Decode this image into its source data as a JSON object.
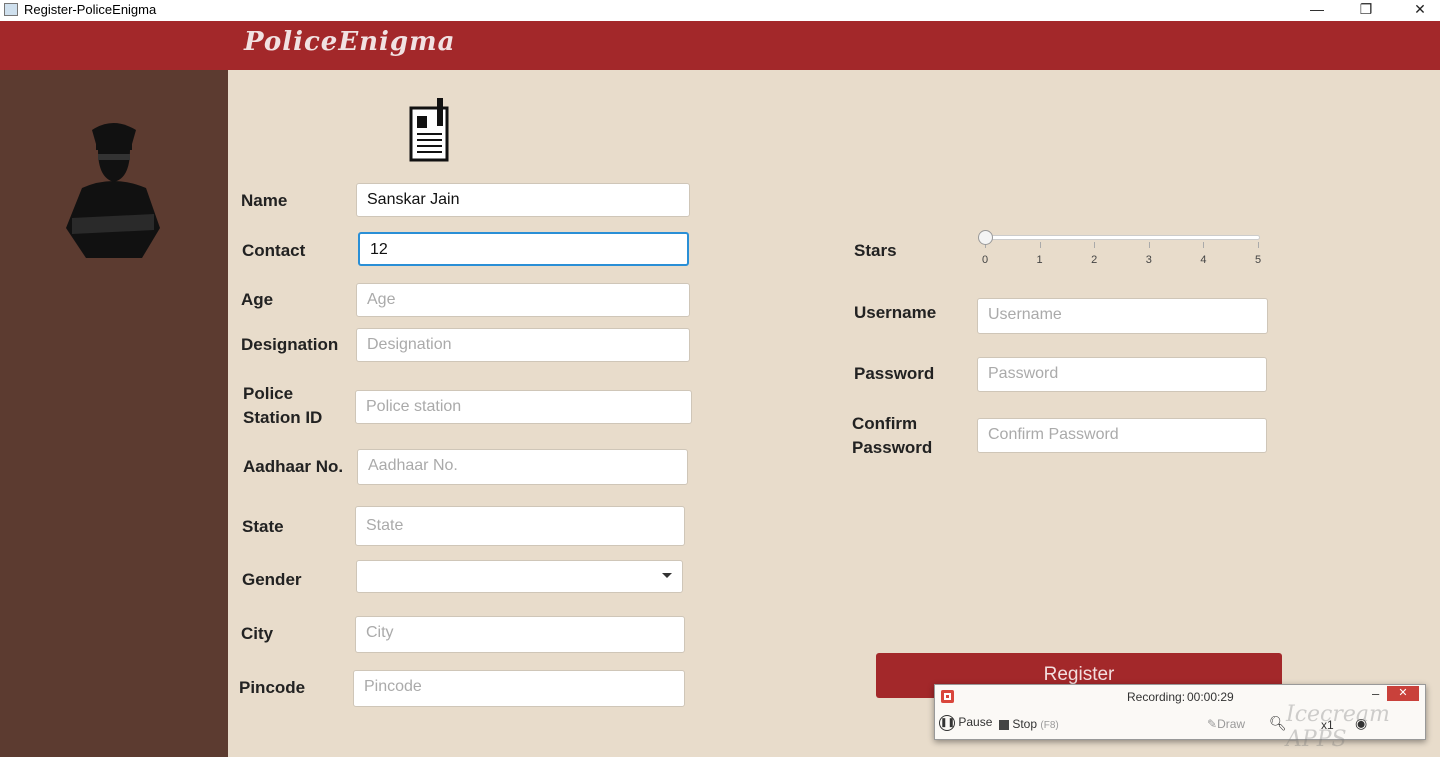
{
  "window": {
    "title": "Register-PoliceEnigma",
    "minimize": "—",
    "restore": "❐",
    "close": "✕"
  },
  "header": {
    "logo": "PoliceEnigma"
  },
  "form": {
    "name": {
      "label": "Name",
      "value": "Sanskar Jain"
    },
    "contact": {
      "label": "Contact",
      "value": "12"
    },
    "age": {
      "label": "Age",
      "placeholder": "Age"
    },
    "designation": {
      "label": "Designation",
      "placeholder": "Designation"
    },
    "police_station": {
      "label_1": "Police",
      "label_2": "Station ID",
      "placeholder": "Police station"
    },
    "aadhaar": {
      "label": "Aadhaar No.",
      "placeholder": "Aadhaar No."
    },
    "state": {
      "label": "State",
      "placeholder": "State"
    },
    "gender": {
      "label": "Gender",
      "value": ""
    },
    "city": {
      "label": "City",
      "placeholder": "City"
    },
    "pincode": {
      "label": "Pincode",
      "placeholder": "Pincode"
    },
    "stars": {
      "label": "Stars",
      "value": 0,
      "min": 0,
      "max": 5,
      "ticks": [
        "0",
        "1",
        "2",
        "3",
        "4",
        "5"
      ]
    },
    "username": {
      "label": "Username",
      "placeholder": "Username"
    },
    "password": {
      "label": "Password",
      "placeholder": "Password"
    },
    "confirm": {
      "label_1": "Confirm",
      "label_2": "Password",
      "placeholder": "Confirm Password"
    },
    "register": "Register"
  },
  "recorder": {
    "status": "Recording:",
    "time": "00:00:29",
    "pause": "Pause",
    "stop": "Stop",
    "stop_key": "(F8)",
    "draw": "Draw",
    "zoom": "x1",
    "watermark": "Icecream APPS"
  },
  "colors": {
    "header": "#a3282a",
    "sidebar": "#5c3b30",
    "background": "#e8dccb"
  }
}
